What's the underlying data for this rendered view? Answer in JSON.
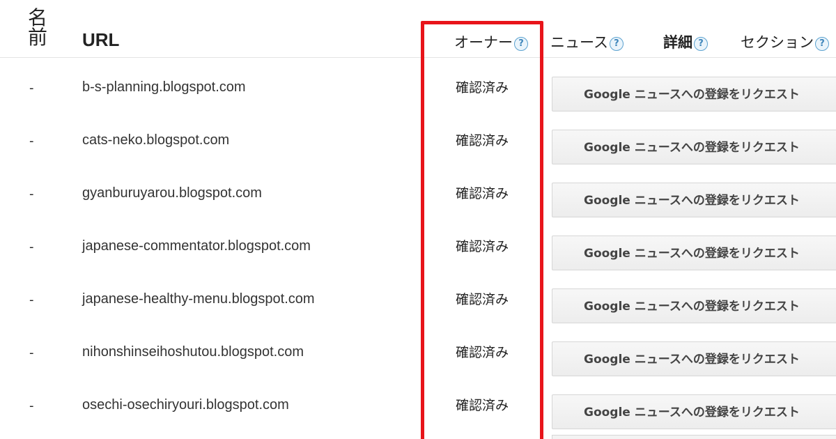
{
  "header": {
    "name": "名前",
    "url": "URL",
    "owner": "オーナー",
    "news": "ニュース",
    "detail": "詳細",
    "section": "セクション",
    "help_glyph": "?"
  },
  "rows": [
    {
      "name": "-",
      "url": "b-s-planning.blogspot.com",
      "owner": "確認済み",
      "button": "Google ニュースへの登録をリクエスト"
    },
    {
      "name": "-",
      "url": "cats-neko.blogspot.com",
      "owner": "確認済み",
      "button": "Google ニュースへの登録をリクエスト"
    },
    {
      "name": "-",
      "url": "gyanburuyarou.blogspot.com",
      "owner": "確認済み",
      "button": "Google ニュースへの登録をリクエスト"
    },
    {
      "name": "-",
      "url": "japanese-commentator.blogspot.com",
      "owner": "確認済み",
      "button": "Google ニュースへの登録をリクエスト"
    },
    {
      "name": "-",
      "url": "japanese-healthy-menu.blogspot.com",
      "owner": "確認済み",
      "button": "Google ニュースへの登録をリクエスト"
    },
    {
      "name": "-",
      "url": "nihonshinseihoshutou.blogspot.com",
      "owner": "確認済み",
      "button": "Google ニュースへの登録をリクエスト"
    },
    {
      "name": "-",
      "url": "osechi-osechiryouri.blogspot.com",
      "owner": "確認済み",
      "button": "Google ニュースへの登録をリクエスト"
    }
  ],
  "colors": {
    "highlight": "#e8141a",
    "help_icon": "#5aa1cf"
  },
  "icons": {
    "help": "help-icon"
  }
}
